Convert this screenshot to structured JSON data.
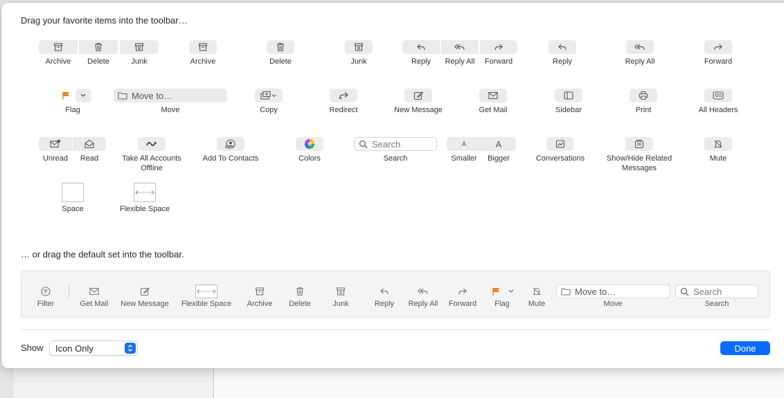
{
  "sheet": {
    "heading_top": "Drag your favorite items into the toolbar…",
    "heading_default": "… or drag the default set into the toolbar."
  },
  "palette": {
    "row1": [
      "Archive",
      "Delete",
      "Junk",
      "Archive",
      "Delete",
      "Junk",
      "Reply",
      "Reply All",
      "Forward",
      "Reply",
      "Reply All",
      "Forward"
    ],
    "row2": [
      "Flag",
      "Move",
      "Copy",
      "Redirect",
      "New Message",
      "Get Mail",
      "Sidebar",
      "Print",
      "All Headers"
    ],
    "move_placeholder": "Move to…",
    "row3": [
      "Unread",
      "Read",
      "Take All Accounts Offline",
      "Add To Contacts",
      "Colors",
      "Search",
      "Smaller",
      "Bigger",
      "Conversations",
      "Show/Hide Related Messages",
      "Mute"
    ],
    "search_placeholder": "Search",
    "smaller_glyph": "A",
    "bigger_glyph": "A",
    "row4": [
      "Space",
      "Flexible Space"
    ]
  },
  "default_set": {
    "labels": [
      "Filter",
      "Get Mail",
      "New Message",
      "Flexible Space",
      "Archive",
      "Delete",
      "Junk",
      "Reply",
      "Reply All",
      "Forward",
      "Flag",
      "Mute",
      "Move",
      "Search"
    ],
    "move_placeholder": "Move to…",
    "search_placeholder": "Search"
  },
  "footer": {
    "show_label": "Show",
    "show_value": "Icon Only",
    "done_label": "Done"
  },
  "colors": {
    "accent": "#0a6cff",
    "flag": "#f5811f"
  }
}
